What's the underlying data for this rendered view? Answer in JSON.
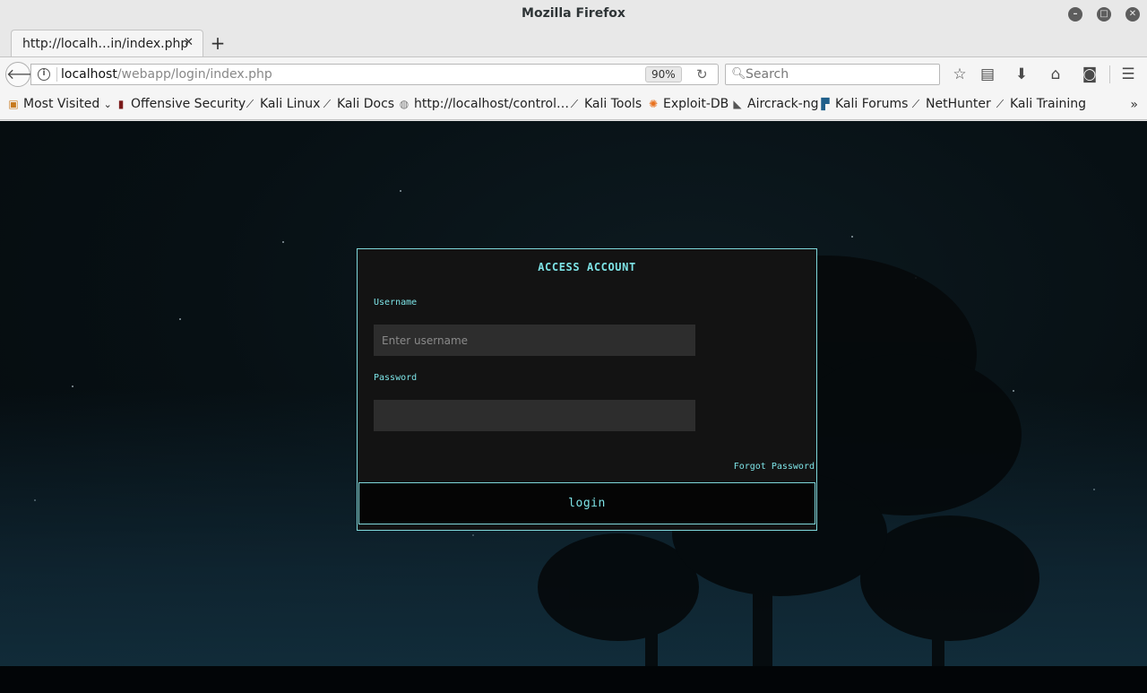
{
  "window": {
    "title": "Mozilla Firefox"
  },
  "tabs": [
    {
      "title": "http://localh…in/index.php",
      "active": true
    }
  ],
  "navbar": {
    "url_host": "localhost",
    "url_path": "/webapp/login/index.php",
    "zoom": "90%",
    "search_placeholder": "Search"
  },
  "bookmarks": [
    {
      "label": "Most Visited",
      "icon": "folder-icon"
    },
    {
      "label": "Offensive Security",
      "icon": "offsec-icon"
    },
    {
      "label": "Kali Linux",
      "icon": "kali-dragon-icon"
    },
    {
      "label": "Kali Docs",
      "icon": "kali-dragon-icon"
    },
    {
      "label": "http://localhost/control…",
      "icon": "globe-icon"
    },
    {
      "label": "Kali Tools",
      "icon": "kali-dragon-icon"
    },
    {
      "label": "Exploit-DB",
      "icon": "exploitdb-icon"
    },
    {
      "label": "Aircrack-ng",
      "icon": "aircrack-icon"
    },
    {
      "label": "Kali Forums",
      "icon": "kali-forums-icon"
    },
    {
      "label": "NetHunter",
      "icon": "kali-dragon-icon"
    },
    {
      "label": "Kali Training",
      "icon": "kali-dragon-icon"
    }
  ],
  "login": {
    "title": "ACCESS ACCOUNT",
    "username_label": "Username",
    "username_placeholder": "Enter username",
    "username_value": "",
    "password_label": "Password",
    "password_value": "",
    "forgot_label": "Forgot Password",
    "submit_label": "login"
  },
  "colors": {
    "accent": "#7de3e6",
    "card_bg": "#131313",
    "input_bg": "#2d2d2d",
    "page_bg": "#071014"
  }
}
